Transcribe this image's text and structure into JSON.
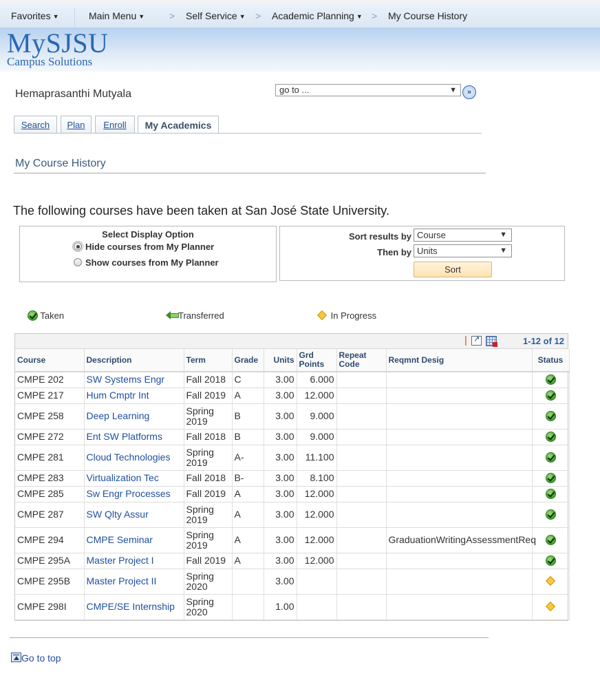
{
  "topnav": {
    "favorites": "Favorites",
    "main_menu": "Main Menu",
    "breadcrumbs": [
      "Self Service",
      "Academic Planning",
      "My Course History"
    ],
    "separator": ">"
  },
  "header": {
    "logo_main": "MySJSU",
    "logo_sub": "Campus Solutions"
  },
  "student_name": "Hemaprasanthi Mutyala",
  "goto": {
    "value": "go to ...",
    "button_label": "»"
  },
  "tabs": [
    {
      "label": "Search",
      "active": false
    },
    {
      "label": "Plan",
      "active": false
    },
    {
      "label": "Enroll",
      "active": false
    },
    {
      "label": "My Academics",
      "active": true
    }
  ],
  "page_title": "My Course History",
  "intro_text": "The following courses have been taken at San José State University.",
  "display_option": {
    "title": "Select Display Option",
    "options": [
      {
        "label": "Hide courses from My Planner",
        "checked": true
      },
      {
        "label": "Show courses from My Planner",
        "checked": false
      }
    ]
  },
  "sort": {
    "sort_by_label": "Sort results by",
    "sort_by_value": "Course",
    "then_by_label": "Then by",
    "then_by_value": "Units",
    "button_label": "Sort"
  },
  "legend": {
    "taken": "Taken",
    "transferred": "Transferred",
    "in_progress": "In Progress"
  },
  "grid": {
    "count": "1-12 of 12",
    "columns": [
      "Course",
      "Description",
      "Term",
      "Grade",
      "Units",
      "Grd Points",
      "Repeat Code",
      "Reqmnt Desig",
      "Status"
    ],
    "rows": [
      {
        "course": "CMPE 202",
        "description": "SW Systems Engr",
        "term": "Fall 2018",
        "grade": "C",
        "units": "3.00",
        "grd_points": "6.000",
        "repeat_code": "",
        "reqmnt_desig": "",
        "status": "taken"
      },
      {
        "course": "CMPE 217",
        "description": "Hum Cmptr Int",
        "term": "Fall 2019",
        "grade": "A",
        "units": "3.00",
        "grd_points": "12.000",
        "repeat_code": "",
        "reqmnt_desig": "",
        "status": "taken"
      },
      {
        "course": "CMPE 258",
        "description": "Deep Learning",
        "term": "Spring 2019",
        "grade": "B",
        "units": "3.00",
        "grd_points": "9.000",
        "repeat_code": "",
        "reqmnt_desig": "",
        "status": "taken"
      },
      {
        "course": "CMPE 272",
        "description": "Ent SW Platforms",
        "term": "Fall 2018",
        "grade": "B",
        "units": "3.00",
        "grd_points": "9.000",
        "repeat_code": "",
        "reqmnt_desig": "",
        "status": "taken"
      },
      {
        "course": "CMPE 281",
        "description": "Cloud Technologies",
        "term": "Spring 2019",
        "grade": "A-",
        "units": "3.00",
        "grd_points": "11.100",
        "repeat_code": "",
        "reqmnt_desig": "",
        "status": "taken"
      },
      {
        "course": "CMPE 283",
        "description": "Virtualization Tec",
        "term": "Fall 2018",
        "grade": "B-",
        "units": "3.00",
        "grd_points": "8.100",
        "repeat_code": "",
        "reqmnt_desig": "",
        "status": "taken"
      },
      {
        "course": "CMPE 285",
        "description": "Sw Engr Processes",
        "term": "Fall 2019",
        "grade": "A",
        "units": "3.00",
        "grd_points": "12.000",
        "repeat_code": "",
        "reqmnt_desig": "",
        "status": "taken"
      },
      {
        "course": "CMPE 287",
        "description": "SW Qlty Assur",
        "term": "Spring 2019",
        "grade": "A",
        "units": "3.00",
        "grd_points": "12.000",
        "repeat_code": "",
        "reqmnt_desig": "",
        "status": "taken"
      },
      {
        "course": "CMPE 294",
        "description": "CMPE Seminar",
        "term": "Spring 2019",
        "grade": "A",
        "units": "3.00",
        "grd_points": "12.000",
        "repeat_code": "",
        "reqmnt_desig": "GraduationWritingAssessmentReq",
        "status": "taken"
      },
      {
        "course": "CMPE 295A",
        "description": "Master Project I",
        "term": "Fall 2019",
        "grade": "A",
        "units": "3.00",
        "grd_points": "12.000",
        "repeat_code": "",
        "reqmnt_desig": "",
        "status": "taken"
      },
      {
        "course": "CMPE 295B",
        "description": "Master Project II",
        "term": "Spring 2020",
        "grade": "",
        "units": "3.00",
        "grd_points": "",
        "repeat_code": "",
        "reqmnt_desig": "",
        "status": "in_progress"
      },
      {
        "course": "CMPE 298I",
        "description": "CMPE/SE Internship",
        "term": "Spring 2020",
        "grade": "",
        "units": "1.00",
        "grd_points": "",
        "repeat_code": "",
        "reqmnt_desig": "",
        "status": "in_progress"
      }
    ]
  },
  "go_to_top": "Go to top",
  "colors": {
    "link": "#1f4e9e",
    "taken_green": "#3f9f2a",
    "in_progress_yellow": "#f7c83c",
    "sort_button": "#fde2b2"
  }
}
